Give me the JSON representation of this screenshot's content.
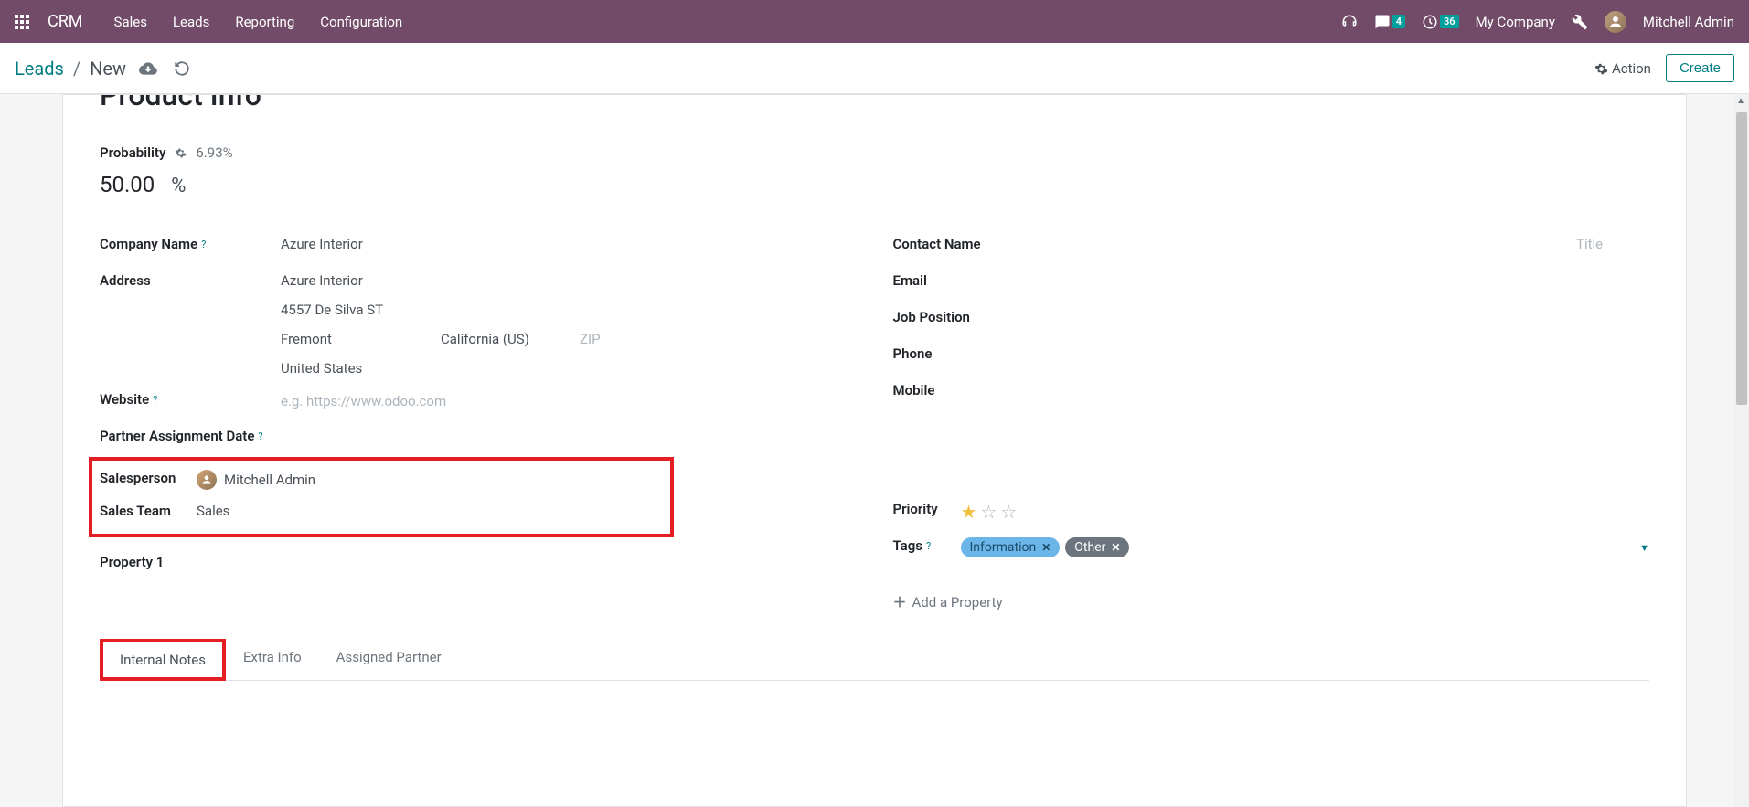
{
  "navbar": {
    "brand": "CRM",
    "menu": [
      "Sales",
      "Leads",
      "Reporting",
      "Configuration"
    ],
    "messages_badge": "4",
    "activities_badge": "36",
    "company": "My Company",
    "user": "Mitchell Admin"
  },
  "breadcrumb": {
    "parent": "Leads",
    "current": "New",
    "action_label": "Action",
    "create_label": "Create"
  },
  "form": {
    "title_partial": "Product Info",
    "probability": {
      "label": "Probability",
      "hint": "6.93%",
      "value": "50.00",
      "unit": "%"
    },
    "left": {
      "company_name": {
        "label": "Company Name",
        "value": "Azure Interior"
      },
      "address": {
        "label": "Address",
        "street1": "Azure Interior",
        "street2": "4557 De Silva ST",
        "city": "Fremont",
        "state": "California (US)",
        "zip_placeholder": "ZIP",
        "country": "United States"
      },
      "website": {
        "label": "Website",
        "placeholder": "e.g. https://www.odoo.com"
      },
      "partner_assignment": {
        "label": "Partner Assignment Date"
      },
      "salesperson": {
        "label": "Salesperson",
        "value": "Mitchell Admin"
      },
      "sales_team": {
        "label": "Sales Team",
        "value": "Sales"
      },
      "property1": {
        "label": "Property 1"
      }
    },
    "right": {
      "contact_name": {
        "label": "Contact Name",
        "title_placeholder": "Title"
      },
      "email": {
        "label": "Email"
      },
      "job_position": {
        "label": "Job Position"
      },
      "phone": {
        "label": "Phone"
      },
      "mobile": {
        "label": "Mobile"
      },
      "priority": {
        "label": "Priority",
        "value": 1
      },
      "tags": {
        "label": "Tags",
        "items": [
          {
            "text": "Information",
            "color": "#6bb5e8"
          },
          {
            "text": "Other",
            "color": "#6c757d"
          }
        ]
      },
      "add_property": "Add a Property"
    },
    "tabs": [
      "Internal Notes",
      "Extra Info",
      "Assigned Partner"
    ]
  }
}
